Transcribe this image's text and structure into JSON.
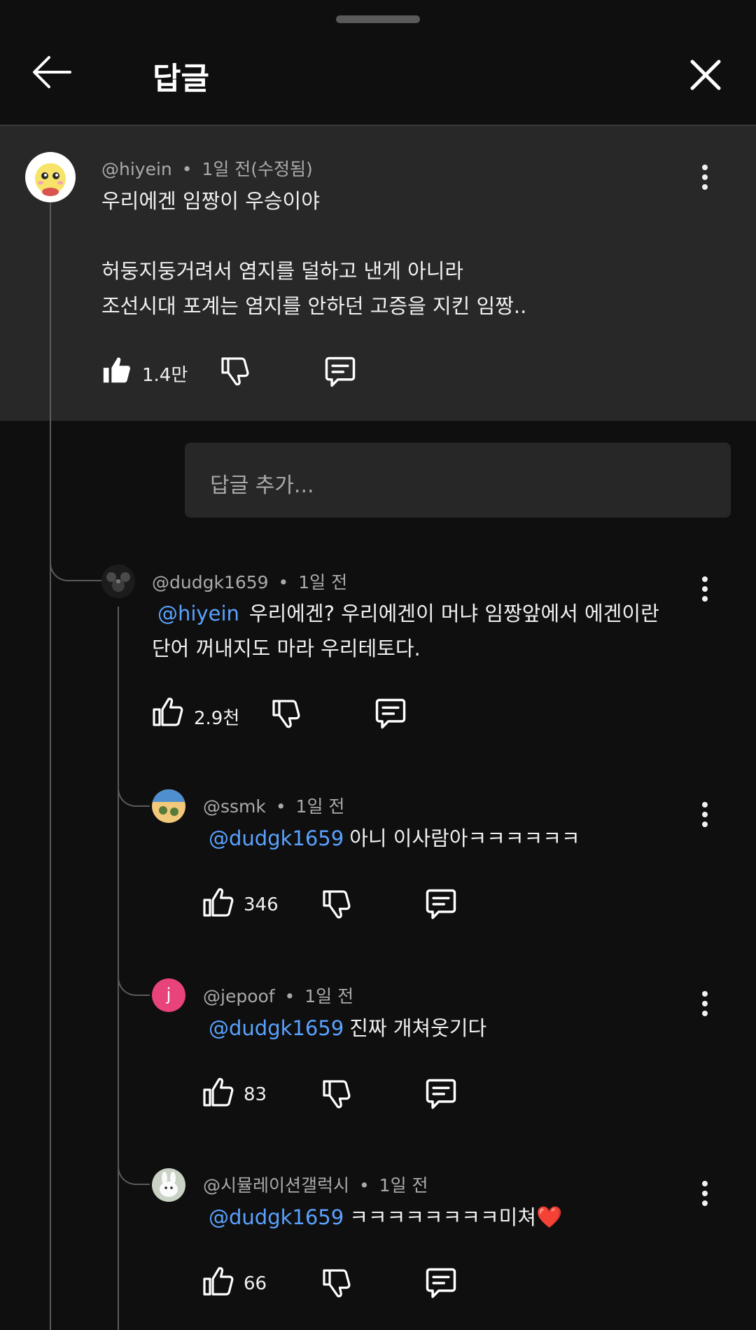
{
  "header": {
    "title": "답글"
  },
  "parent_comment": {
    "handle": "@hiyein",
    "time": "1일 전(수정됨)",
    "text_lines": [
      "우리에겐 임짱이 우승이야",
      "",
      "허둥지둥거려서 염지를 덜하고 낸게 아니라",
      "조선시대 포계는 염지를 안하던 고증을 지킨 임짱.."
    ],
    "likes": "1.4만"
  },
  "reply_input": {
    "placeholder": "답글 추가..."
  },
  "reply1": {
    "handle": "@dudgk1659",
    "time": "1일 전",
    "mention": "@hiyein",
    "text1": "우리에겐? 우리에겐이 머냐 임짱앞에서 에겐이란",
    "text2": "단어 꺼내지도 마라 우리테토다.",
    "likes": "2.9천"
  },
  "replies": [
    {
      "handle": "@ssmk",
      "time": "1일 전",
      "mention": "@dudgk1659",
      "text": "아니 이사람아ㅋㅋㅋㅋㅋㅋ",
      "likes": "346"
    },
    {
      "handle": "@jepoof",
      "time": "1일 전",
      "mention": "@dudgk1659",
      "text": "진짜 개쳐웃기다",
      "likes": "83",
      "avatar_letter": "j"
    },
    {
      "handle": "@시뮬레이션갤럭시",
      "time": "1일 전",
      "mention": "@dudgk1659",
      "text": "ㅋㅋㅋㅋㅋㅋㅋㅋ미쳐",
      "likes": "66",
      "emoji": "❤️"
    }
  ],
  "separator": "•",
  "colors": {
    "background": "#0f0f0f",
    "parent_bg": "#282828",
    "mention": "#5aa2ff",
    "jepoof_avatar": "#e8437a"
  }
}
